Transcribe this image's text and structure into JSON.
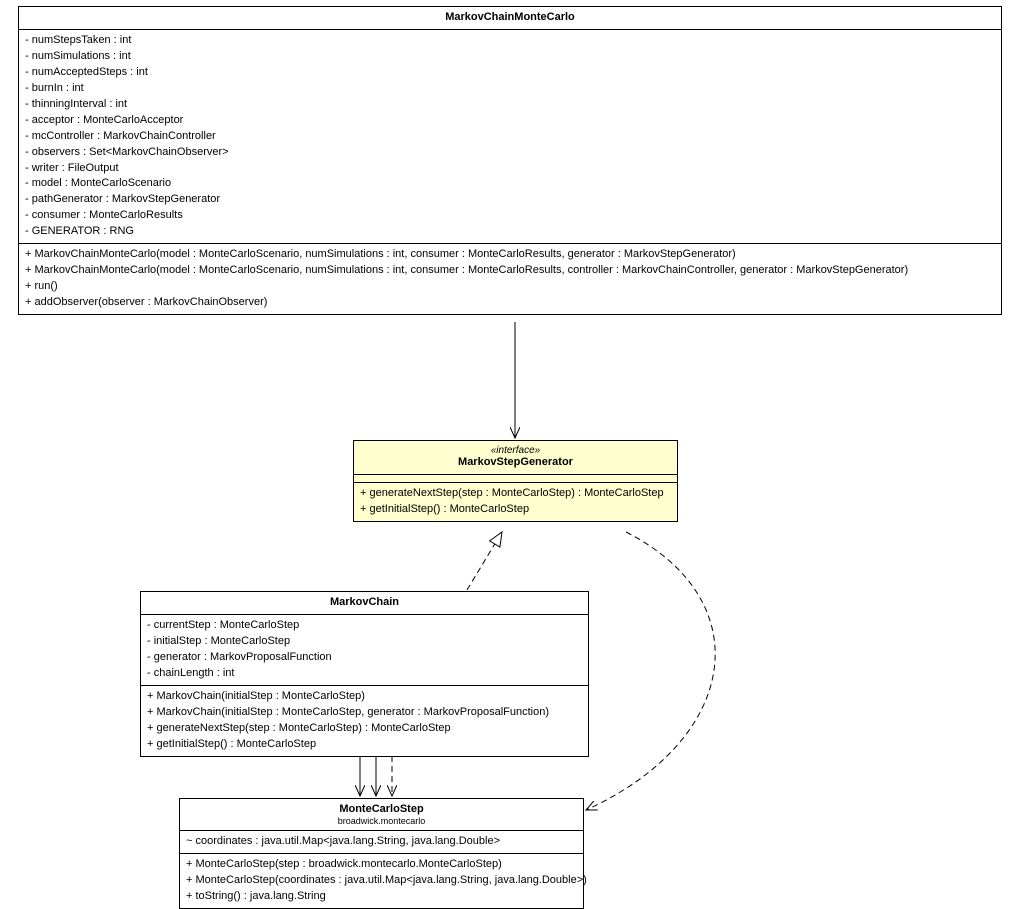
{
  "classes": {
    "mcmc": {
      "name": "MarkovChainMonteCarlo",
      "fields": [
        "- numStepsTaken : int",
        "- numSimulations : int",
        "- numAcceptedSteps : int",
        "- burnIn : int",
        "- thinningInterval : int",
        "- acceptor : MonteCarloAcceptor",
        "- mcController : MarkovChainController",
        "- observers : Set<MarkovChainObserver>",
        "- writer : FileOutput",
        "- model : MonteCarloScenario",
        "- pathGenerator : MarkovStepGenerator",
        "- consumer : MonteCarloResults",
        "- GENERATOR : RNG"
      ],
      "methods": [
        "+ MarkovChainMonteCarlo(model : MonteCarloScenario, numSimulations : int, consumer : MonteCarloResults, generator : MarkovStepGenerator)",
        "+ MarkovChainMonteCarlo(model : MonteCarloScenario, numSimulations : int, consumer : MonteCarloResults, controller : MarkovChainController, generator : MarkovStepGenerator)",
        "+ run()",
        "+ addObserver(observer : MarkovChainObserver)"
      ]
    },
    "msg": {
      "stereotype": "«interface»",
      "name": "MarkovStepGenerator",
      "methods": [
        "+ generateNextStep(step : MonteCarloStep) : MonteCarloStep",
        "+ getInitialStep() : MonteCarloStep"
      ]
    },
    "mc": {
      "name": "MarkovChain",
      "fields": [
        "- currentStep : MonteCarloStep",
        "- initialStep : MonteCarloStep",
        "- generator : MarkovProposalFunction",
        "- chainLength : int"
      ],
      "methods": [
        "+ MarkovChain(initialStep : MonteCarloStep)",
        "+ MarkovChain(initialStep : MonteCarloStep, generator : MarkovProposalFunction)",
        "+ generateNextStep(step : MonteCarloStep) : MonteCarloStep",
        "+ getInitialStep() : MonteCarloStep"
      ]
    },
    "mcs": {
      "name": "MonteCarloStep",
      "subtitle": "broadwick.montecarlo",
      "fields": [
        "~ coordinates : java.util.Map<java.lang.String, java.lang.Double>"
      ],
      "methods": [
        "+ MonteCarloStep(step : broadwick.montecarlo.MonteCarloStep)",
        "+ MonteCarloStep(coordinates : java.util.Map<java.lang.String, java.lang.Double>)",
        "+ toString() : java.lang.String"
      ]
    }
  }
}
